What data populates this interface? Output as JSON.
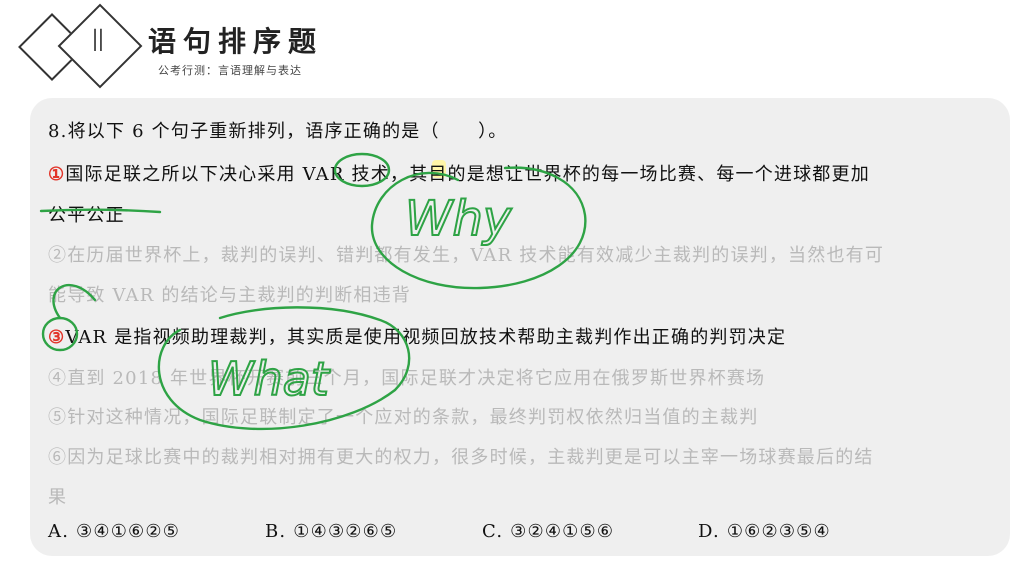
{
  "header": {
    "section_number": "Ⅱ",
    "title": "语句排序题",
    "subtitle": "公考行测：言语理解与表达"
  },
  "question": {
    "stem": "8.将以下 6 个句子重新排列，语序正确的是（　　）。",
    "s1_marker": "①",
    "s1_line1": "国际足联之所以下决心采用 VAR 技术，其目的是想让世界杯的每一场比赛、每一个进球都更加",
    "s1_line2": "公平公正",
    "s2_line1": "②在历届世界杯上，裁判的误判、错判都有发生，VAR 技术能有效减少主裁判的误判，当然也有可",
    "s2_line2": "能导致 VAR 的结论与主裁判的判断相违背",
    "s3_marker": "③",
    "s3_line1": "VAR 是指视频助理裁判，其实质是使用视频回放技术帮助主裁判作出正确的判罚决定",
    "s4_line1": "④直到 2018 年世界杯开赛前三个月，国际足联才决定将它应用在俄罗斯世界杯赛场",
    "s5_line1": "⑤针对这种情况，国际足联制定了一个应对的条款，最终判罚权依然归当值的主裁判",
    "s6_line1": "⑥因为足球比赛中的裁判相对拥有更大的权力，很多时候，主裁判更是可以主宰一场球赛最后的结",
    "s6_line2": "果",
    "options": [
      "A. ③④①⑥②⑤",
      "B. ①④③②⑥⑤",
      "C. ③②④①⑤⑥",
      "D. ①⑥②③⑤④"
    ]
  },
  "annotations": {
    "handwriting_why": "Why",
    "handwriting_what": "What",
    "ink_color": "#2ea345",
    "marker_color": "#e2352a"
  }
}
